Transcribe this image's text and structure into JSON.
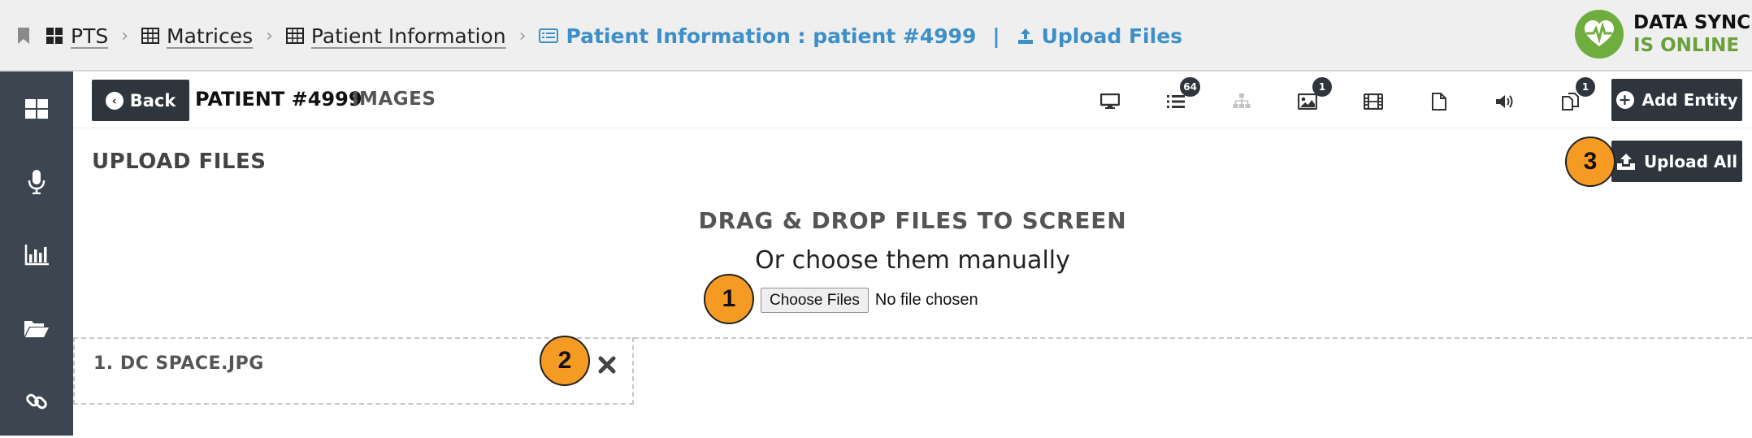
{
  "breadcrumb": {
    "items": [
      {
        "label": "PTS",
        "icon": "grid-icon"
      },
      {
        "label": "Matrices",
        "icon": "table-icon"
      },
      {
        "label": "Patient Information",
        "icon": "table-icon"
      }
    ],
    "current": {
      "label": "Patient Information : patient #4999",
      "icon": "list-alt-icon"
    },
    "separator": "|",
    "sub_current": {
      "label": "Upload Files",
      "icon": "upload-icon"
    }
  },
  "sync_status": {
    "line1": "DATA SYNC",
    "line2": "IS ONLINE",
    "color": "#6fae3e"
  },
  "sidebar": {
    "items": [
      {
        "name": "dashboard",
        "icon": "grid-icon"
      },
      {
        "name": "microphone",
        "icon": "microphone-icon"
      },
      {
        "name": "charts",
        "icon": "bar-chart-icon"
      },
      {
        "name": "folders",
        "icon": "folder-open-icon"
      },
      {
        "name": "links",
        "icon": "link-icon"
      }
    ]
  },
  "toolbar": {
    "back_label": "Back",
    "patient_title": "PATIENT #4999",
    "section_label": "IMAGES",
    "icons": [
      {
        "name": "desktop-icon",
        "badge": null
      },
      {
        "name": "list-icon",
        "badge": "64"
      },
      {
        "name": "sitemap-icon",
        "badge": null
      },
      {
        "name": "image-icon",
        "badge": "1"
      },
      {
        "name": "film-icon",
        "badge": null
      },
      {
        "name": "file-icon",
        "badge": null
      },
      {
        "name": "volume-icon",
        "badge": null
      },
      {
        "name": "copy-icon",
        "badge": "1"
      }
    ],
    "add_entity_label": "Add Entity"
  },
  "upload": {
    "header": "UPLOAD FILES",
    "upload_all_label": "Upload All",
    "drag_title": "DRAG & DROP FILES TO SCREEN",
    "choose_text": "Or choose them manually",
    "choose_button": "Choose Files",
    "no_file_text": "No file chosen",
    "files": [
      {
        "label": "1. DC SPACE.JPG"
      }
    ]
  },
  "callouts": [
    "1",
    "2",
    "3"
  ],
  "colors": {
    "accent_blue": "#3c8fc9",
    "dark_button": "#2f353c",
    "sidebar": "#3d4650",
    "callout": "#f59a23",
    "online_green": "#6aa13a"
  }
}
